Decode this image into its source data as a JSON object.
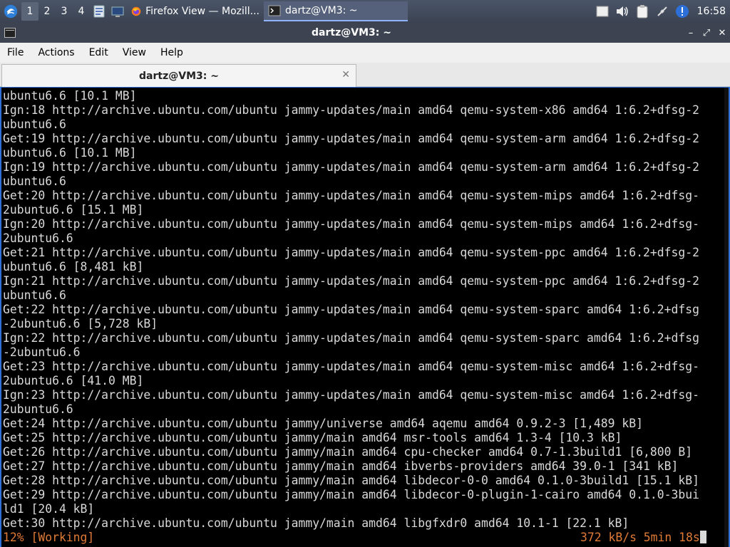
{
  "taskbar": {
    "workspaces": [
      "1",
      "2",
      "3",
      "4"
    ],
    "tasks": [
      {
        "label": "Firefox View — Mozill...",
        "icon": "firefox-icon"
      },
      {
        "label": "dartz@VM3: ~",
        "icon": "terminal-icon"
      }
    ],
    "clock": "16:58"
  },
  "window": {
    "title": "dartz@VM3: ~"
  },
  "menu": [
    "File",
    "Actions",
    "Edit",
    "View",
    "Help"
  ],
  "tabs": [
    {
      "label": "dartz@VM3: ~"
    }
  ],
  "terminal": {
    "lines": [
      "ubuntu6.6 [10.1 MB]",
      "Ign:18 http://archive.ubuntu.com/ubuntu jammy-updates/main amd64 qemu-system-x86 amd64 1:6.2+dfsg-2",
      "ubuntu6.6",
      "Get:19 http://archive.ubuntu.com/ubuntu jammy-updates/main amd64 qemu-system-arm amd64 1:6.2+dfsg-2",
      "ubuntu6.6 [10.1 MB]",
      "Ign:19 http://archive.ubuntu.com/ubuntu jammy-updates/main amd64 qemu-system-arm amd64 1:6.2+dfsg-2",
      "ubuntu6.6",
      "Get:20 http://archive.ubuntu.com/ubuntu jammy-updates/main amd64 qemu-system-mips amd64 1:6.2+dfsg-",
      "2ubuntu6.6 [15.1 MB]",
      "Ign:20 http://archive.ubuntu.com/ubuntu jammy-updates/main amd64 qemu-system-mips amd64 1:6.2+dfsg-",
      "2ubuntu6.6",
      "Get:21 http://archive.ubuntu.com/ubuntu jammy-updates/main amd64 qemu-system-ppc amd64 1:6.2+dfsg-2",
      "ubuntu6.6 [8,481 kB]",
      "Ign:21 http://archive.ubuntu.com/ubuntu jammy-updates/main amd64 qemu-system-ppc amd64 1:6.2+dfsg-2",
      "ubuntu6.6",
      "Get:22 http://archive.ubuntu.com/ubuntu jammy-updates/main amd64 qemu-system-sparc amd64 1:6.2+dfsg",
      "-2ubuntu6.6 [5,728 kB]",
      "Ign:22 http://archive.ubuntu.com/ubuntu jammy-updates/main amd64 qemu-system-sparc amd64 1:6.2+dfsg",
      "-2ubuntu6.6",
      "Get:23 http://archive.ubuntu.com/ubuntu jammy-updates/main amd64 qemu-system-misc amd64 1:6.2+dfsg-",
      "2ubuntu6.6 [41.0 MB]",
      "Ign:23 http://archive.ubuntu.com/ubuntu jammy-updates/main amd64 qemu-system-misc amd64 1:6.2+dfsg-",
      "2ubuntu6.6",
      "Get:24 http://archive.ubuntu.com/ubuntu jammy/universe amd64 aqemu amd64 0.9.2-3 [1,489 kB]",
      "Get:25 http://archive.ubuntu.com/ubuntu jammy/main amd64 msr-tools amd64 1.3-4 [10.3 kB]",
      "Get:26 http://archive.ubuntu.com/ubuntu jammy/main amd64 cpu-checker amd64 0.7-1.3build1 [6,800 B]",
      "Get:27 http://archive.ubuntu.com/ubuntu jammy/main amd64 ibverbs-providers amd64 39.0-1 [341 kB]",
      "Get:28 http://archive.ubuntu.com/ubuntu jammy/main amd64 libdecor-0-0 amd64 0.1.0-3build1 [15.1 kB]",
      "Get:29 http://archive.ubuntu.com/ubuntu jammy/main amd64 libdecor-0-plugin-1-cairo amd64 0.1.0-3bui",
      "ld1 [20.4 kB]",
      "Get:30 http://archive.ubuntu.com/ubuntu jammy/main amd64 libgfxdr0 amd64 10.1-1 [22.1 kB]"
    ],
    "status_left": "12% [Working]",
    "status_right": "372 kB/s 5min 18s",
    "status_color": "#e07a37"
  }
}
